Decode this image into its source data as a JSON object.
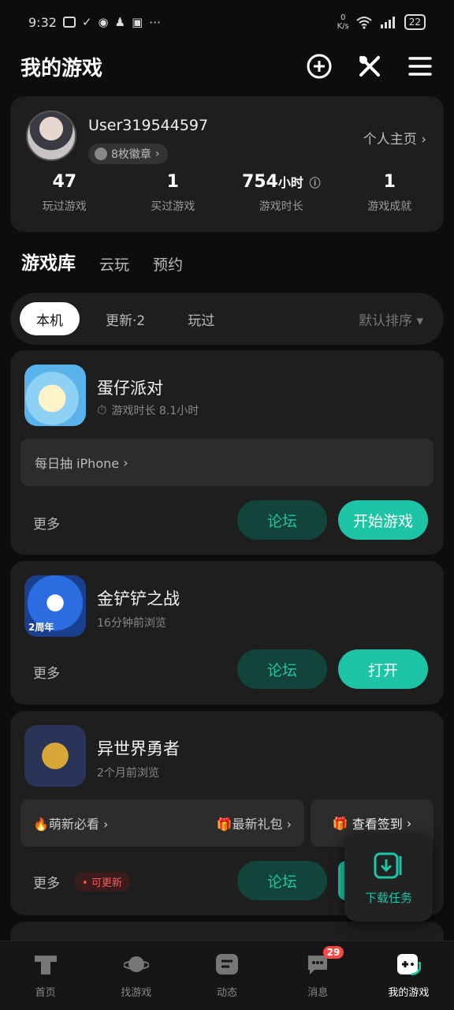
{
  "status": {
    "time": "9:32",
    "net_speed_top": "0",
    "net_speed_bottom": "K/s",
    "battery": "22"
  },
  "header": {
    "title": "我的游戏"
  },
  "profile": {
    "username": "User319544597",
    "badges": "8枚徽章",
    "homepage": "个人主页",
    "stats": [
      {
        "value": "47",
        "unit": "",
        "label": "玩过游戏"
      },
      {
        "value": "1",
        "unit": "",
        "label": "买过游戏"
      },
      {
        "value": "754",
        "unit": "小时",
        "label": "游戏时长"
      },
      {
        "value": "1",
        "unit": "",
        "label": "游戏成就"
      }
    ]
  },
  "library_tabs": [
    "游戏库",
    "云玩",
    "预约"
  ],
  "filters": {
    "chips": [
      "本机",
      "更新·2",
      "玩过"
    ],
    "sort": "默认排序"
  },
  "games": [
    {
      "name": "蛋仔派对",
      "sub": "游戏时长 8.1小时",
      "banner": "每日抽 iPhone",
      "more": "更多",
      "forum": "论坛",
      "action": "开始游戏"
    },
    {
      "name": "金铲铲之战",
      "sub": "16分钟前浏览",
      "more": "更多",
      "forum": "论坛",
      "action": "打开",
      "icon_text": "2周年"
    },
    {
      "name": "异世界勇者",
      "sub": "2个月前浏览",
      "banner_left": "萌新必看",
      "banner_mid": "最新礼包",
      "banner_right": "查看签到",
      "more": "更多",
      "update_tag": "可更新",
      "forum": "论坛"
    }
  ],
  "float": {
    "label": "下载任务"
  },
  "bottom_nav": [
    {
      "label": "首页"
    },
    {
      "label": "找游戏"
    },
    {
      "label": "动态"
    },
    {
      "label": "消息",
      "badge": "29"
    },
    {
      "label": "我的游戏"
    }
  ],
  "colors": {
    "accent": "#1ec4a6",
    "card": "#1e1e1e",
    "background": "#0d0d0d"
  }
}
